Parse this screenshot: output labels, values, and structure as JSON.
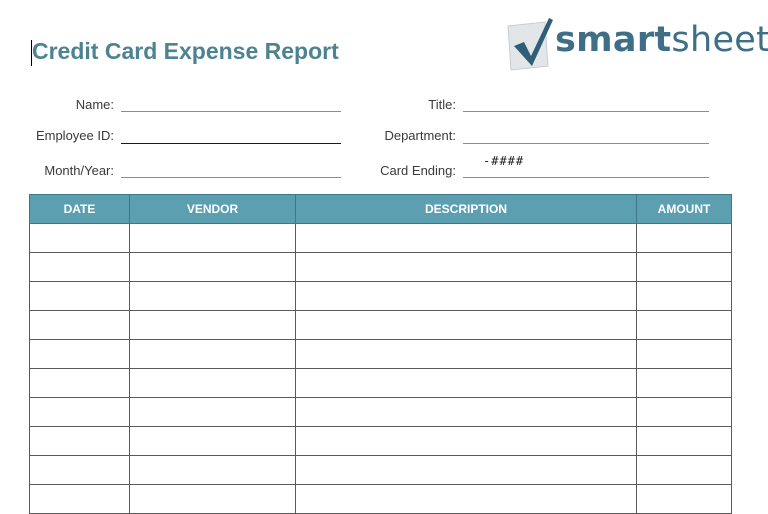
{
  "header": {
    "title": "Credit Card Expense Report",
    "logo_text_bold": "smart",
    "logo_text_regular": "sheet",
    "logo_icon": "checkmark-icon"
  },
  "fields": {
    "name_label": "Name:",
    "employee_id_label": "Employee ID:",
    "month_year_label": "Month/Year:",
    "title_label": "Title:",
    "department_label": "Department:",
    "card_ending_label": "Card Ending:",
    "card_ending_value": "-####"
  },
  "table": {
    "columns": [
      "DATE",
      "VENDOR",
      "DESCRIPTION",
      "AMOUNT"
    ],
    "rows": [
      [
        "",
        "",
        "",
        ""
      ],
      [
        "",
        "",
        "",
        ""
      ],
      [
        "",
        "",
        "",
        ""
      ],
      [
        "",
        "",
        "",
        ""
      ],
      [
        "",
        "",
        "",
        ""
      ],
      [
        "",
        "",
        "",
        ""
      ],
      [
        "",
        "",
        "",
        ""
      ],
      [
        "",
        "",
        "",
        ""
      ],
      [
        "",
        "",
        "",
        ""
      ],
      [
        "",
        "",
        "",
        ""
      ]
    ]
  },
  "colors": {
    "title": "#4d8391",
    "header_fill": "#5b9fb1",
    "logo": "#3f6f86"
  }
}
